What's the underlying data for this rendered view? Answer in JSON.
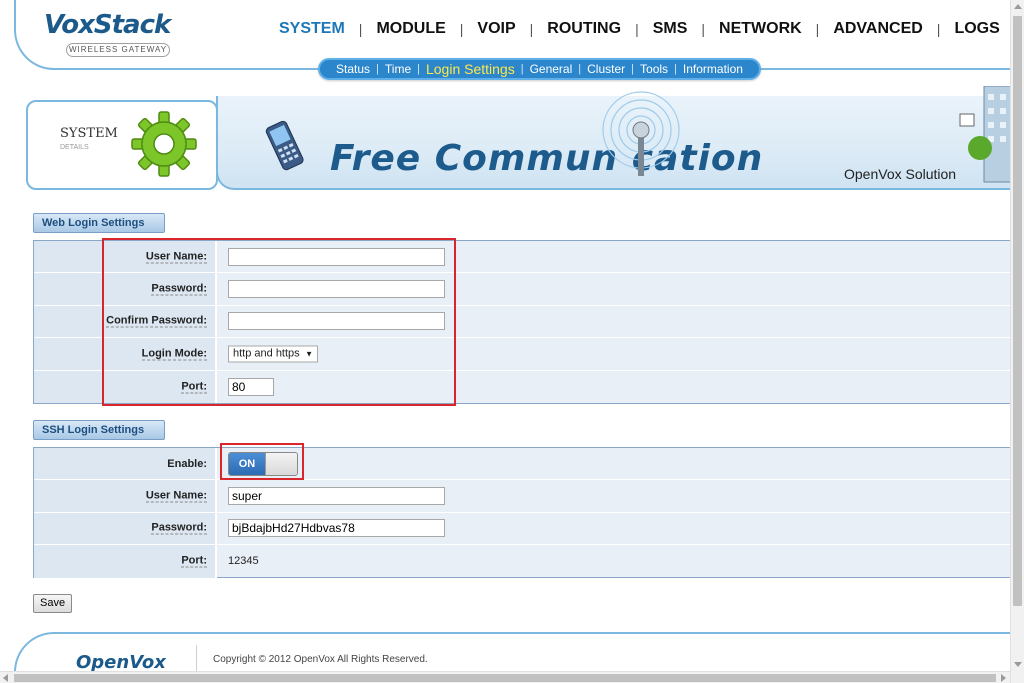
{
  "brand": {
    "name": "VoxStack",
    "tagline": "WIRELESS GATEWAY"
  },
  "top_nav": [
    {
      "label": "SYSTEM",
      "active": true
    },
    {
      "label": "MODULE"
    },
    {
      "label": "VOIP"
    },
    {
      "label": "ROUTING"
    },
    {
      "label": "SMS"
    },
    {
      "label": "NETWORK"
    },
    {
      "label": "ADVANCED"
    },
    {
      "label": "LOGS"
    }
  ],
  "sub_nav": [
    {
      "label": "Status"
    },
    {
      "label": "Time"
    },
    {
      "label": "Login Settings",
      "active": true
    },
    {
      "label": "General"
    },
    {
      "label": "Cluster"
    },
    {
      "label": "Tools"
    },
    {
      "label": "Information"
    }
  ],
  "banner": {
    "section_title": "SYSTEM",
    "section_sub": "DETAILS",
    "slogan": "Free Commun  cation",
    "solution": "OpenVox Solution"
  },
  "web_login": {
    "tab": "Web Login Settings",
    "user_name_label": "User Name:",
    "user_name_value": "",
    "password_label": "Password:",
    "password_value": "",
    "confirm_password_label": "Confirm Password:",
    "confirm_password_value": "",
    "login_mode_label": "Login Mode:",
    "login_mode_value": "http and https",
    "port_label": "Port:",
    "port_value": "80"
  },
  "ssh_login": {
    "tab": "SSH Login Settings",
    "enable_label": "Enable:",
    "enable_state": "ON",
    "user_name_label": "User Name:",
    "user_name_value": "super",
    "password_label": "Password:",
    "password_value": "bjBdajbHd27Hdbvas78",
    "port_label": "Port:",
    "port_value": "12345"
  },
  "actions": {
    "save_label": "Save"
  },
  "footer": {
    "logo": "OpenVox",
    "copyright": "Copyright © 2012 OpenVox All Rights Reserved."
  },
  "colors": {
    "accent": "#1e78b8",
    "sub_nav_bg": "#2b86cc",
    "sub_nav_active": "#ffe84a",
    "highlight_border": "#d9262c",
    "table_bg": "#e9eff6"
  }
}
